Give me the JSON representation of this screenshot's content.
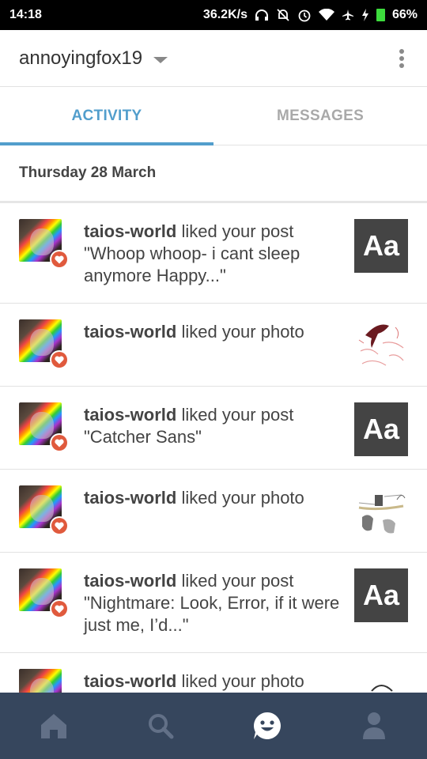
{
  "status_bar": {
    "time": "14:18",
    "speed": "36.2K/s",
    "battery": "66%"
  },
  "header": {
    "account_name": "annoyingfox19"
  },
  "tabs": [
    {
      "label": "ACTIVITY",
      "active": true
    },
    {
      "label": "MESSAGES",
      "active": false
    }
  ],
  "date_header": "Thursday 28 March",
  "activity": [
    {
      "user": "taios-world",
      "action": " liked your post",
      "quote": "\"Whoop whoop- i cant sleep anymore  Happy...\"",
      "thumb": "text",
      "thumb_label": "Aa"
    },
    {
      "user": "taios-world",
      "action": " liked your photo",
      "quote": "",
      "thumb": "photo"
    },
    {
      "user": "taios-world",
      "action": " liked your post",
      "quote": "\"Catcher Sans\"",
      "thumb": "text",
      "thumb_label": "Aa"
    },
    {
      "user": "taios-world",
      "action": " liked your photo",
      "quote": "",
      "thumb": "photo"
    },
    {
      "user": "taios-world",
      "action": " liked your post",
      "quote": "\"Nightmare: Look, Error, if it were just me, I’d...\"",
      "thumb": "text",
      "thumb_label": "Aa"
    },
    {
      "user": "taios-world",
      "action": " liked your photo",
      "quote": "",
      "thumb": "photo"
    }
  ],
  "bottom_nav": [
    {
      "name": "home",
      "icon": "home-icon"
    },
    {
      "name": "search",
      "icon": "search-icon"
    },
    {
      "name": "activity",
      "icon": "smiley-chat-icon",
      "active": true
    },
    {
      "name": "account",
      "icon": "person-icon"
    }
  ],
  "colors": {
    "accent": "#529ecc",
    "nav_bg": "#36465d",
    "heart": "#e05a3d",
    "text_thumb": "#444444"
  }
}
